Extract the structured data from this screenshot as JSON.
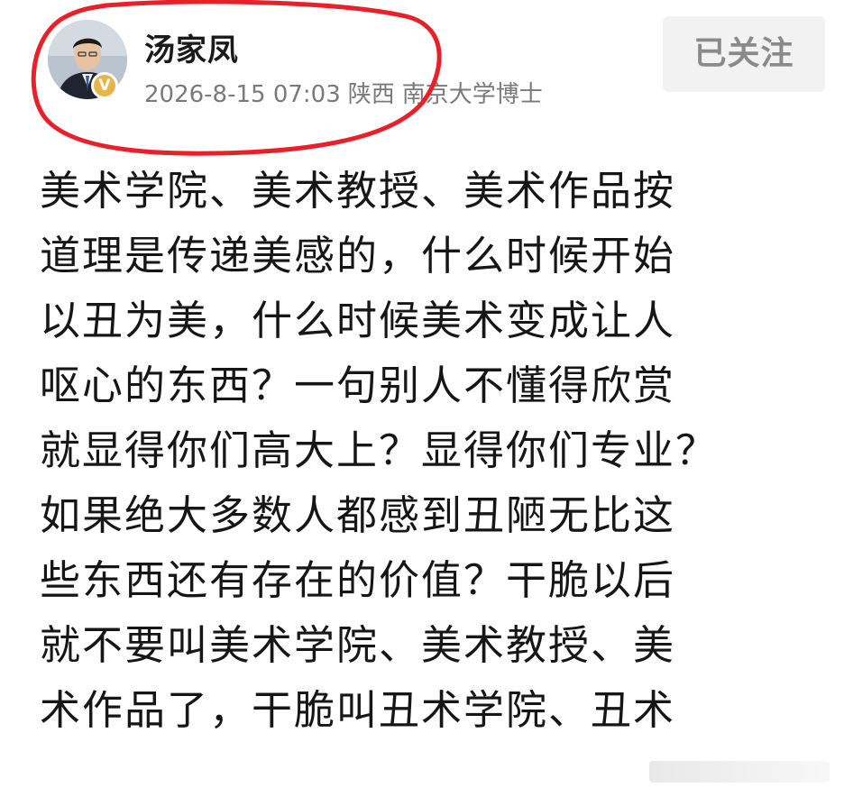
{
  "post": {
    "author": {
      "name": "汤家凤",
      "verified_mark": "V"
    },
    "timestamp": "2026-8-15 07:03",
    "location": "陕西",
    "bio": "南京大学博士",
    "follow_label": "已关注",
    "body_lines": [
      "美术学院、美术教授、美术作品按",
      "道理是传递美感的，什么时候开始",
      "以丑为美，什么时候美术变成让人",
      "呕心的东西？一句别人不懂得欣赏",
      "就显得你们高大上？显得你们专业？",
      "如果绝大多数人都感到丑陋无比这",
      "些东西还有存在的价值？干脆以后",
      "就不要叫美术学院、美术教授、美",
      "术作品了，干脆叫丑术学院、丑术"
    ]
  },
  "colors": {
    "annotation_circle": "#e8202a",
    "verified_badge": "#e7b54a",
    "follow_bg": "#f2f2f2",
    "text": "#161616",
    "meta_text": "#7a7a7a"
  },
  "icons": {
    "avatar": "profile-photo",
    "verified": "verified-badge-icon"
  }
}
